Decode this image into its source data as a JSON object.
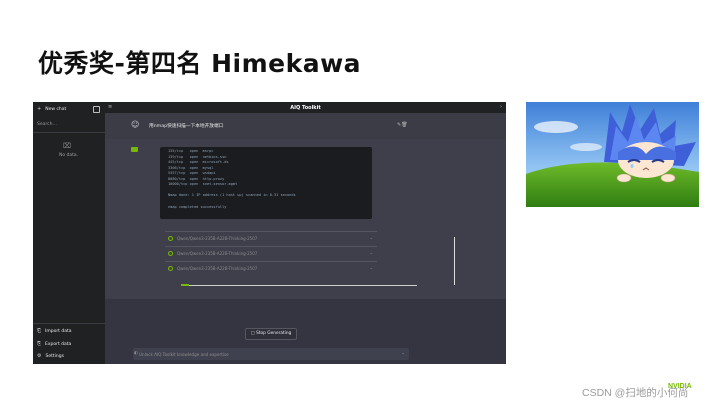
{
  "slide": {
    "title": "优秀奖-第四名 Himekawa"
  },
  "app": {
    "window_title": "AIQ Toolkit",
    "sidebar": {
      "new_chat": "New chat",
      "search_placeholder": "Search...",
      "no_data": "No data.",
      "bottom_items": [
        {
          "label": "Import data",
          "icon": "import-icon"
        },
        {
          "label": "Export data",
          "icon": "export-icon"
        },
        {
          "label": "Settings",
          "icon": "gear-icon"
        }
      ]
    },
    "user_message": "用nmap快速扫描一下本地开放端口",
    "terminal_lines": [
      "135/tcp   open  msrpc",
      "139/tcp   open  netbios-ssn",
      "445/tcp   open  microsoft-ds",
      "3306/tcp  open  mysql",
      "5357/tcp  open  wsdapi",
      "8080/tcp  open  http-proxy",
      "10000/tcp open  snet-sensor-mgmt",
      "",
      "Nmap done: 1 IP address (1 host up) scanned in 0.31 seconds",
      "",
      "nmap completed successfully"
    ],
    "tool_calls": [
      {
        "name": "Qwen/Qwen3-235B-A22B-Thinking-2507"
      },
      {
        "name": "Qwen/Qwen3-235B-A22B-Thinking-2507"
      },
      {
        "name": "Qwen/Qwen3-235B-A22B-Thinking-2507"
      }
    ],
    "stop_button": "Stop Generating",
    "input_placeholder": "Unlock AIQ Toolkit knowledge and expertise"
  },
  "footer": {
    "watermark": "CSDN @扫地的小何尚",
    "logo_text": "NVIDIA"
  },
  "colors": {
    "accent": "#76b900",
    "app_bg": "#343541",
    "sidebar_bg": "#202123"
  }
}
